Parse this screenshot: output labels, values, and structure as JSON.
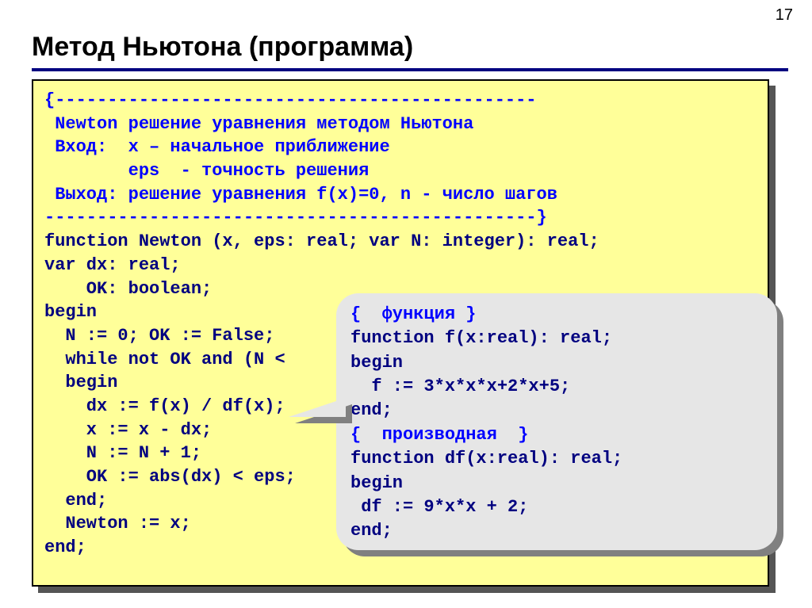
{
  "page_number": "17",
  "title": "Метод Ньютона (программа)",
  "code": {
    "l1": "{----------------------------------------------",
    "l2": " Newton решение уравнения методом Ньютона",
    "l3": " Вход:  x – начальное приближение",
    "l4": "        eps  - точность решения",
    "l5": " Выход: решение уравнения f(x)=0, n - число шагов",
    "l6": "-----------------------------------------------}",
    "l7": "function Newton (x, eps: real; var N: integer): real;",
    "l8": "var dx: real;",
    "l9": "    OK: boolean;",
    "l10": "begin",
    "l11": "  N := 0; OK := False;",
    "l12": "  while not OK and (N <",
    "l13": "  begin",
    "l14": "    dx := f(x) / df(x);",
    "l15": "    x := x - dx;",
    "l16": "    N := N + 1;",
    "l17": "    OK := abs(dx) < eps;",
    "l18": "  end;",
    "l19": "  Newton := x;",
    "l20": "end;"
  },
  "callout": {
    "l1": "{  функция }",
    "l2": "function f(x:real): real;",
    "l3": "begin",
    "l4": "  f := 3*x*x*x+2*x+5;",
    "l5": "end;",
    "l6": "{  производная  }",
    "l7": "function df(x:real): real;",
    "l8": "begin",
    "l9": " df := 9*x*x + 2;",
    "l10": "end;"
  }
}
